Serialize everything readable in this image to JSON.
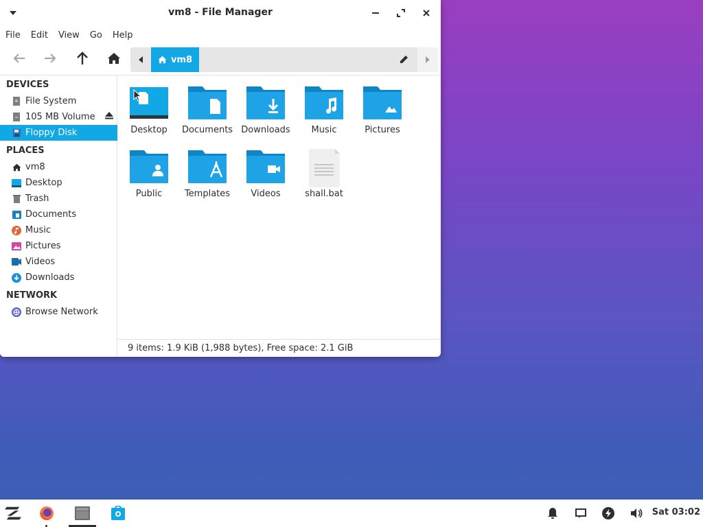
{
  "window": {
    "title": "vm8 - File Manager"
  },
  "menubar": [
    "File",
    "Edit",
    "View",
    "Go",
    "Help"
  ],
  "pathbar": {
    "crumb": "vm8"
  },
  "sidebar": {
    "devices_heading": "DEVICES",
    "devices": [
      {
        "label": "File System",
        "icon": "drive-icon"
      },
      {
        "label": "105 MB Volume",
        "icon": "drive-icon"
      },
      {
        "label": "Floppy Disk",
        "icon": "floppy-icon"
      }
    ],
    "places_heading": "PLACES",
    "places": [
      {
        "label": "vm8",
        "icon": "home-icon"
      },
      {
        "label": "Desktop",
        "icon": "desktop-icon"
      },
      {
        "label": "Trash",
        "icon": "trash-icon"
      },
      {
        "label": "Documents",
        "icon": "documents-icon"
      },
      {
        "label": "Music",
        "icon": "music-icon"
      },
      {
        "label": "Pictures",
        "icon": "pictures-icon"
      },
      {
        "label": "Videos",
        "icon": "videos-icon"
      },
      {
        "label": "Downloads",
        "icon": "downloads-icon"
      }
    ],
    "network_heading": "NETWORK",
    "network": [
      {
        "label": "Browse Network",
        "icon": "network-icon"
      }
    ]
  },
  "files": [
    {
      "label": "Desktop",
      "icon": "desktop-folder-icon"
    },
    {
      "label": "Documents",
      "icon": "documents-folder-icon"
    },
    {
      "label": "Downloads",
      "icon": "downloads-folder-icon"
    },
    {
      "label": "Music",
      "icon": "music-folder-icon"
    },
    {
      "label": "Pictures",
      "icon": "pictures-folder-icon"
    },
    {
      "label": "Public",
      "icon": "public-folder-icon"
    },
    {
      "label": "Templates",
      "icon": "templates-folder-icon"
    },
    {
      "label": "Videos",
      "icon": "videos-folder-icon"
    },
    {
      "label": "shall.bat",
      "icon": "text-file-icon"
    }
  ],
  "status": "9 items: 1.9 KiB (1,988 bytes), Free space: 2.1 GiB",
  "taskbar": {
    "clock": "Sat 03:02"
  },
  "colors": {
    "accent": "#12a8e6",
    "folder": "#1a9ee0",
    "folder_tab": "#0f85c6"
  }
}
